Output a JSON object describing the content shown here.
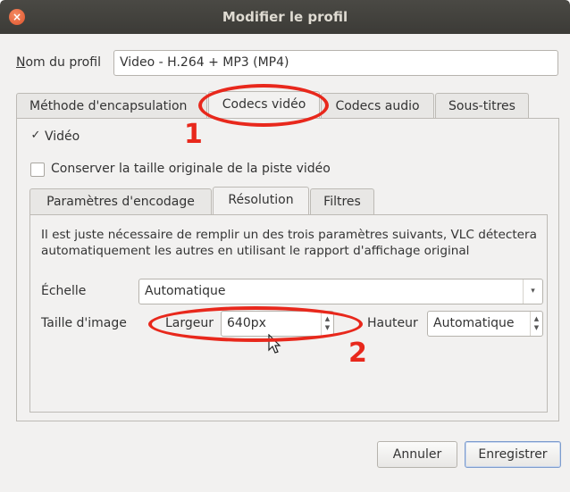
{
  "window": {
    "title": "Modifier le profil",
    "close_glyph": "×"
  },
  "profile": {
    "name_label": "Nom du profil",
    "name_value": "Video - H.264 + MP3 (MP4)"
  },
  "main_tabs": [
    "Méthode d'encapsulation",
    "Codecs vidéo",
    "Codecs audio",
    "Sous-titres"
  ],
  "video": {
    "enable_label": "Vidéo",
    "keep_original_label": "Conserver la taille originale de la piste vidéo"
  },
  "sub_tabs": [
    "Paramètres d'encodage",
    "Résolution",
    "Filtres"
  ],
  "resolution": {
    "info_text": "Il est juste nécessaire de remplir un des trois paramètres suivants, VLC détectera automatiquement les autres en utilisant le rapport d'affichage original",
    "scale_label": "Échelle",
    "scale_value": "Automatique",
    "frame_size_label": "Taille d'image",
    "width_label": "Largeur",
    "width_value": "640px",
    "height_label": "Hauteur",
    "height_value": "Automatique"
  },
  "annotations": {
    "marker1": "1",
    "marker2": "2"
  },
  "buttons": {
    "cancel": "Annuler",
    "save": "Enregistrer"
  },
  "icons": {
    "close": "close-icon",
    "checkmark": "checkmark-icon",
    "dropdown": "chevron-down-icon",
    "spin": "spin-arrows-icon",
    "cursor": "mouse-cursor-icon"
  },
  "colors": {
    "annotation": "#e8281c",
    "titlebar": "#3c3b37",
    "close": "#e0532b"
  }
}
